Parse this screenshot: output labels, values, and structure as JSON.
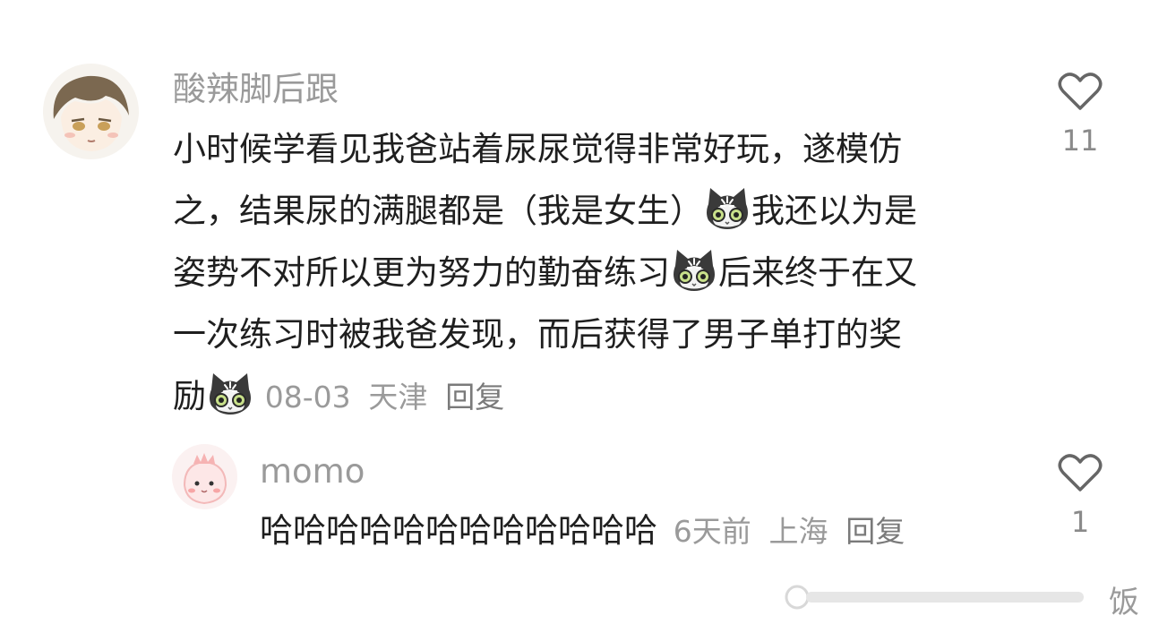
{
  "comments": [
    {
      "username": "酸辣脚后跟",
      "lines": [
        "小时候学看见我爸站着尿尿觉得非常好玩，遂模仿",
        "之，结果尿的满腿都是（我是女生）",
        "我还以为是",
        "姿势不对所以更为努力的勤奋练习",
        "后来终于在又",
        "一次练习时被我爸发现，而后获得了男子单打的奖",
        "励"
      ],
      "date": "08-03",
      "location": "天津",
      "reply_label": "回复",
      "like_count": "11",
      "emoji_icon": "cat-face-emoji-icon"
    },
    {
      "username": "momo",
      "text": "哈哈哈哈哈哈哈哈哈哈哈哈",
      "date": "6天前",
      "location": "上海",
      "reply_label": "回复",
      "like_count": "1"
    }
  ],
  "watermark": "饭",
  "colors": {
    "meta_gray": "#9a9a9a",
    "text": "#1f1f1f",
    "heart_stroke": "#666666"
  }
}
